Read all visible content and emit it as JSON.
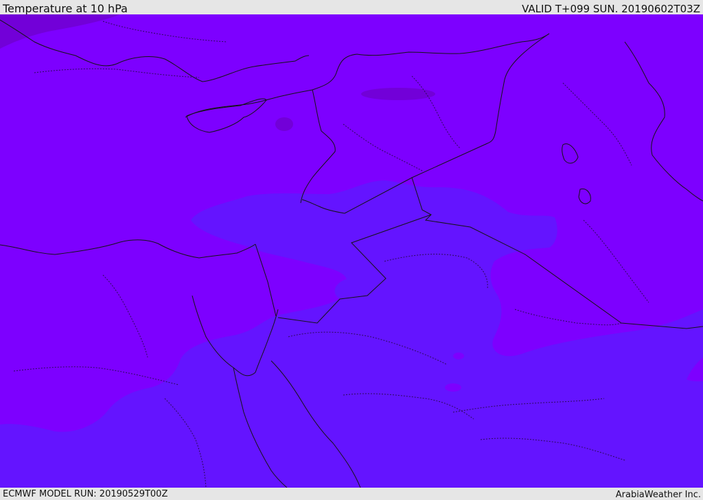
{
  "header": {
    "title": "Temperature at 10 hPa",
    "valid_time": "VALID T+099 SUN. 20190602T03Z"
  },
  "footer": {
    "model_run": "ECMWF MODEL RUN: 20190529T00Z",
    "credit": "ArabiaWeather Inc."
  },
  "map": {
    "colors": {
      "warm_field": "#7d00ff",
      "cool_field": "#6414ff",
      "warmest_patch": "#7200d8",
      "coast_line": "#141414",
      "border_line": "#2a0a55"
    }
  }
}
